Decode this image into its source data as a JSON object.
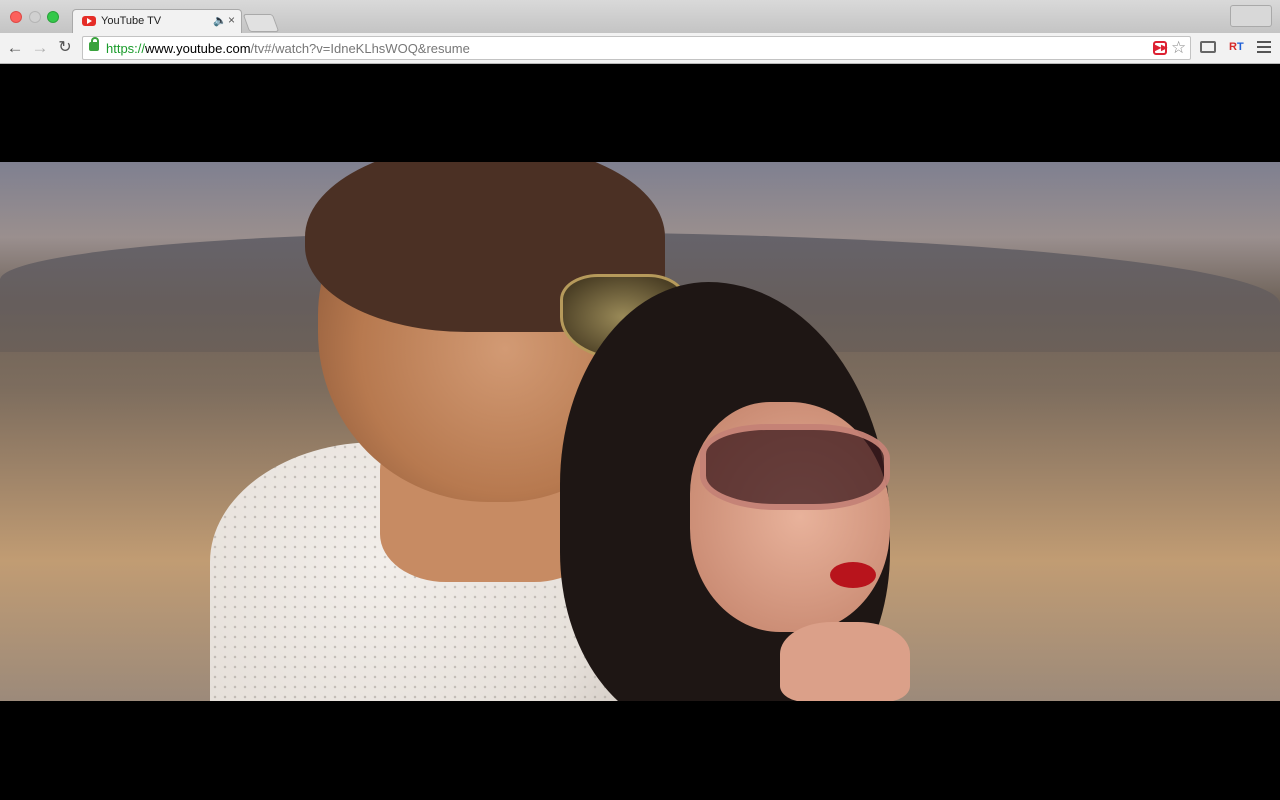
{
  "browser": {
    "tab": {
      "title": "YouTube TV",
      "favicon": "youtube-icon",
      "audio_icon": "🔈",
      "close_icon": "×"
    },
    "nav": {
      "back": "←",
      "forward": "→",
      "reload": "↻"
    },
    "address": {
      "scheme": "https://",
      "host": "www.youtube.com",
      "path": "/tv#/watch?v=IdneKLhsWOQ&resume"
    },
    "extensions": {
      "ff_label": "▶▶",
      "star": "☆",
      "rt_r": "R",
      "rt_t": "T"
    }
  },
  "colors": {
    "accent_green": "#1a9c2b",
    "youtube_red": "#e52d27"
  }
}
